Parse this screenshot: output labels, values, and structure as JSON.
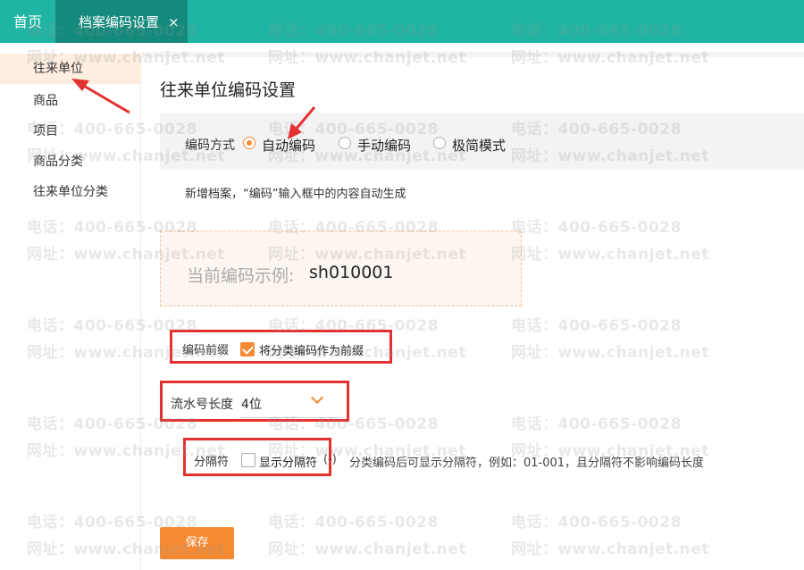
{
  "tabs": {
    "home": "首页",
    "active": "档案编码设置",
    "close_glyph": "×"
  },
  "sidebar": {
    "items": [
      {
        "label": "往来单位",
        "active": true
      },
      {
        "label": "商品",
        "active": false
      },
      {
        "label": "项目",
        "active": false
      },
      {
        "label": "商品分类",
        "active": false
      },
      {
        "label": "往来单位分类",
        "active": false
      }
    ]
  },
  "main": {
    "title": "往来单位编码设置",
    "mode": {
      "label": "编码方式",
      "options": [
        "自动编码",
        "手动编码",
        "极简模式"
      ],
      "selected": "自动编码"
    },
    "hint": "新增档案，“编码”输入框中的内容自动生成",
    "example": {
      "label": "当前编码示例:",
      "value": "sh010001"
    },
    "prefix": {
      "label": "编码前缀",
      "checkbox_label": "将分类编码作为前缀",
      "checked": true
    },
    "serial": {
      "label": "流水号长度",
      "value": "4位"
    },
    "separator": {
      "label": "分隔符",
      "checkbox_label": "显示分隔符",
      "checked": false,
      "paren": "(-)",
      "description": "分类编码后可显示分隔符，例如：01-001，且分隔符不影响编码长度"
    },
    "save_label": "保存"
  },
  "watermark": {
    "phone": "电话：400-665-0028",
    "site": "网址：www.chanjet.net"
  },
  "colors": {
    "topbar": "#1fb5a2",
    "active_tab": "#138a7c",
    "accent": "#f58a33",
    "annotation": "#e53030"
  },
  "icons": {
    "close": "close-icon",
    "dropdown": "chevron-down-icon",
    "annotation_arrow": "red-arrow-icon"
  }
}
